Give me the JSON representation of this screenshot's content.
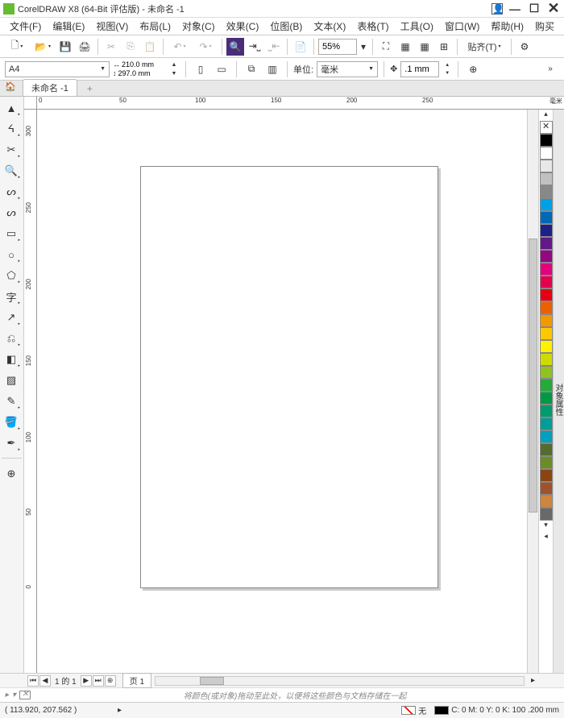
{
  "title": "CorelDRAW X8 (64-Bit 评估版) - 未命名 -1",
  "menu": [
    "文件(F)",
    "编辑(E)",
    "视图(V)",
    "布局(L)",
    "对象(C)",
    "效果(C)",
    "位图(B)",
    "文本(X)",
    "表格(T)",
    "工具(O)",
    "窗口(W)",
    "帮助(H)",
    "购买"
  ],
  "toolbar1": {
    "zoom": "55%",
    "paste_label": "贴齐(T)"
  },
  "toolbar2": {
    "paper": "A4",
    "width": "210.0 mm",
    "height": "297.0 mm",
    "unit_label": "单位:",
    "unit": "毫米",
    "nudge": ".1 mm"
  },
  "doc_tab": "未命名 -1",
  "hruler": {
    "labels": [
      "0",
      "50",
      "100",
      "150",
      "200",
      "250"
    ],
    "unit": "毫米"
  },
  "vruler": {
    "labels": [
      "300",
      "250",
      "200",
      "150",
      "100",
      "50",
      "0"
    ]
  },
  "colors": [
    "transparent",
    "#000000",
    "#ffffff",
    "#00a0e9",
    "#1d2088",
    "#920783",
    "#e4007f",
    "#e60012",
    "#eb6100",
    "#f39800",
    "#fff100",
    "#8fc31f",
    "#009944",
    "#009e96",
    "#556b2f",
    "#8b4513",
    "#696969"
  ],
  "pagebar": {
    "page_info": "1 的 1",
    "page_tab": "页 1"
  },
  "hint": "将颜色(或对象)拖动至此处，以便将这些颜色与文档存储在一起",
  "status": {
    "coords": "( 113.920, 207.562 )",
    "fill_none": "无",
    "outline": "C: 0 M: 0 Y: 0 K: 100  .200 mm"
  },
  "docker_label": "对象属性"
}
